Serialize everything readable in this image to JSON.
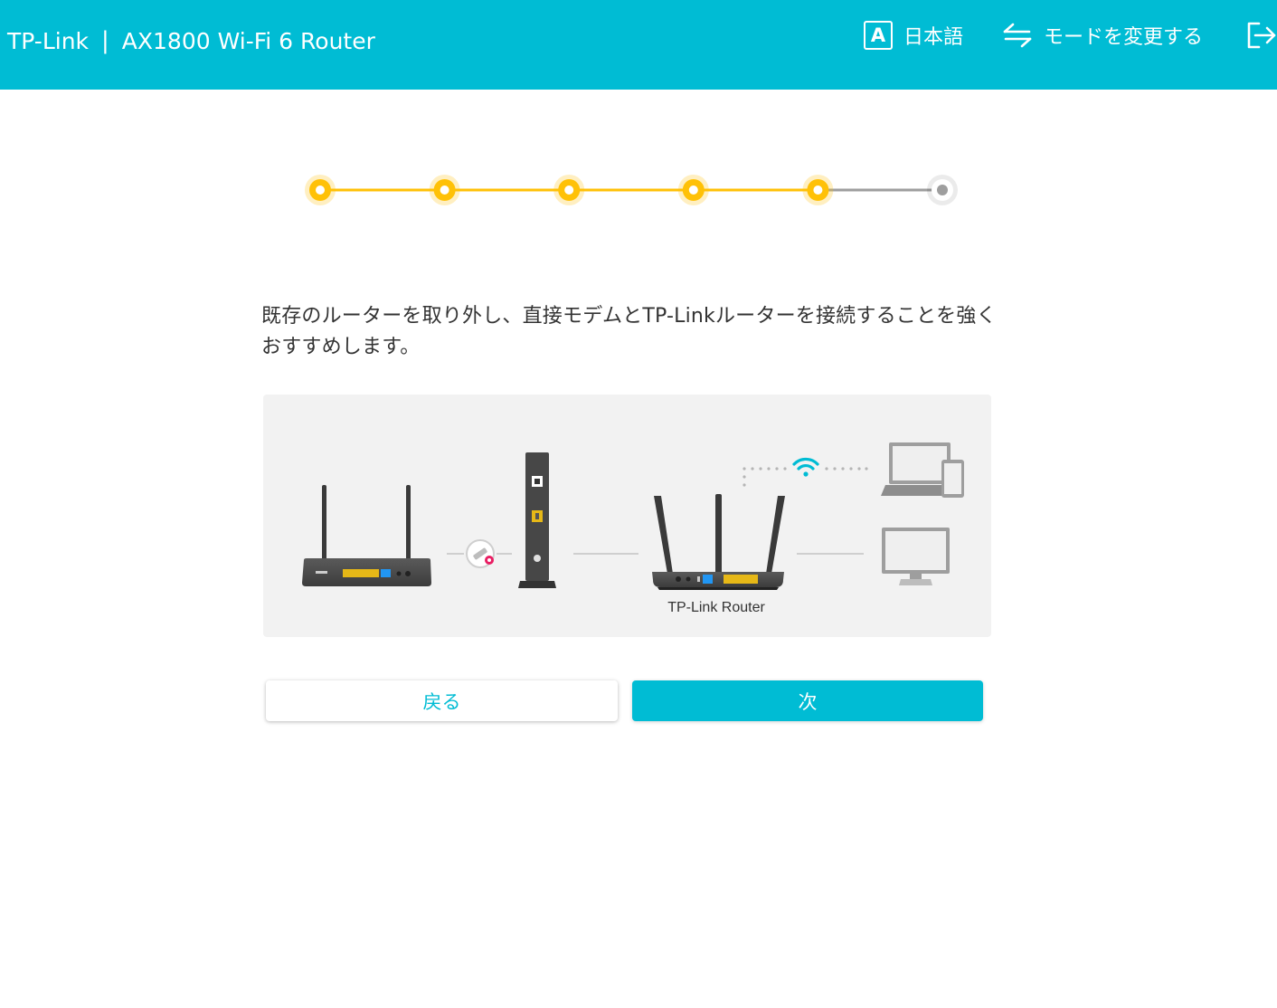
{
  "header": {
    "brand": "TP-Link",
    "separator": "|",
    "product": "AX1800 Wi-Fi 6 Router",
    "language_icon_letter": "A",
    "language_label": "日本語",
    "mode_label": "モードを変更する",
    "icons": [
      "language-icon",
      "swap-icon",
      "logout-icon"
    ]
  },
  "stepper": {
    "total_steps": 6,
    "completed_steps": 5,
    "active_color": "#ffc107",
    "inactive_color": "#9e9e9e"
  },
  "main": {
    "message": "既存のルーターを取り外し、直接モデムとTP-Linkルーターを接続することを強くおすすめします。",
    "diagram": {
      "router_label": "TP-Link Router",
      "icons": [
        "old-router",
        "remove-icon",
        "modem",
        "tp-link-router",
        "wifi-icon",
        "laptop-phone",
        "desktop-monitor"
      ]
    }
  },
  "buttons": {
    "back_label": "戻る",
    "next_label": "次"
  },
  "colors": {
    "primary": "#00bcd4",
    "accent": "#ffc107",
    "remove": "#e91e63"
  }
}
